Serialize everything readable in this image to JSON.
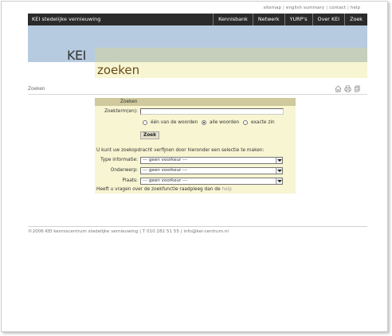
{
  "toplinks": [
    "sitemap",
    "english summary",
    "contact",
    "help"
  ],
  "brand": "KEI stedelijke vernieuwing",
  "nav": [
    "Kennisbank",
    "Netwerk",
    "YURP's",
    "Over KEI",
    "Zoek"
  ],
  "logo": "KEI",
  "page_title": "zoeken",
  "breadcrumb": "Zoeken",
  "icons": [
    "home-icon",
    "print-icon",
    "sitemap-icon"
  ],
  "search": {
    "header": "Zoeken",
    "term_label": "Zoekterm(en):",
    "term_value": "",
    "options": [
      "één van de woorden",
      "alle woorden",
      "exacte zin"
    ],
    "selected_option": 1,
    "button": "Zoek",
    "refine_text": "U kunt uw zoekopdracht verfijnen door hieronder een selectie te maken:",
    "filters": [
      {
        "label": "Type informatie:",
        "value": "--- geen voorkeur ---"
      },
      {
        "label": "Onderwerp:",
        "value": "--- geen voorkeur ---"
      },
      {
        "label": "Plaats:",
        "value": "--- geen voorkeur ---"
      }
    ],
    "help_prefix": "Heeft u vragen over de zoekfunctie raadpleeg dan de",
    "help_link": "help"
  },
  "footer": "©2006 KEI kenniscentrum stedelijke vernieuwing | T 010 282 51 55 | info@kei-centrum.nl",
  "colors": {
    "navbar": "#2b2b2b",
    "band_blue": "#b7cbe0",
    "band_green": "#c5cfbb",
    "band_yellow": "#f7f5d2",
    "title": "#6b4a1a"
  }
}
